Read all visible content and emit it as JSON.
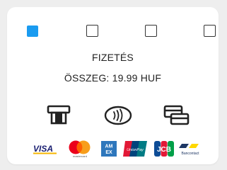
{
  "payment": {
    "title": "FIZETÉS",
    "amount_text": "ÖSSZEG: 19.99 HUF"
  },
  "progress": {
    "total_steps": 4,
    "current_step": 1
  },
  "payment_methods": [
    {
      "name": "card-insert",
      "icon": "card-insert-icon"
    },
    {
      "name": "contactless",
      "icon": "contactless-icon"
    },
    {
      "name": "card-swipe",
      "icon": "card-swipe-icon"
    }
  ],
  "brands": {
    "visa": "VISA",
    "mastercard": "mastercard",
    "amex_top": "AM",
    "amex_bottom": "EX",
    "unionpay": "UnionPay",
    "jcb": "JCB",
    "bancontact": "Bancontact"
  },
  "colors": {
    "accent": "#1a9bf0",
    "text": "#222222",
    "visa": "#1a1f71",
    "mastercard_red": "#eb001b",
    "mastercard_orange": "#f79e1b",
    "amex": "#2e77bc",
    "unionpay_red": "#e21836",
    "unionpay_blue": "#00447c",
    "unionpay_teal": "#007b84",
    "bancontact_blue": "#1e3764",
    "bancontact_yellow": "#ffd800"
  }
}
